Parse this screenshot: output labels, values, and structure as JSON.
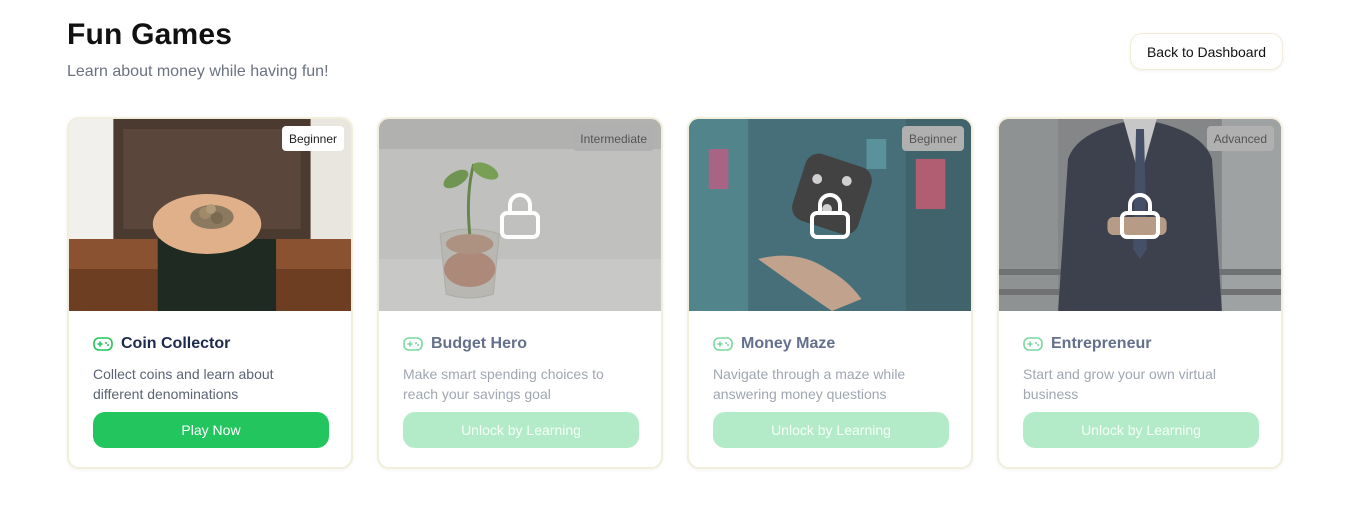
{
  "header": {
    "title": "Fun Games",
    "subtitle": "Learn about money while having fun!",
    "back_button": "Back to Dashboard"
  },
  "games": [
    {
      "title": "Coin Collector",
      "level": "Beginner",
      "description": "Collect coins and learn about different denominations",
      "button": "Play Now",
      "locked": false,
      "image": "hands-holding-coins"
    },
    {
      "title": "Budget Hero",
      "level": "Intermediate",
      "description": "Make smart spending choices to reach your savings goal",
      "button": "Unlock by Learning",
      "locked": true,
      "image": "plant-in-coin-jar"
    },
    {
      "title": "Money Maze",
      "level": "Beginner",
      "description": "Navigate through a maze while answering money questions",
      "button": "Unlock by Learning",
      "locked": true,
      "image": "hand-tossing-dice"
    },
    {
      "title": "Entrepreneur",
      "level": "Advanced",
      "description": "Start and grow your own virtual business",
      "button": "Unlock by Learning",
      "locked": true,
      "image": "businessman-in-suit"
    }
  ],
  "colors": {
    "accent": "#22c55e",
    "accent_disabled": "#b3ebc8",
    "title": "#111111",
    "subtitle": "#6b7280"
  },
  "icons": {
    "game": "gamepad-icon",
    "lock": "lock-icon"
  }
}
